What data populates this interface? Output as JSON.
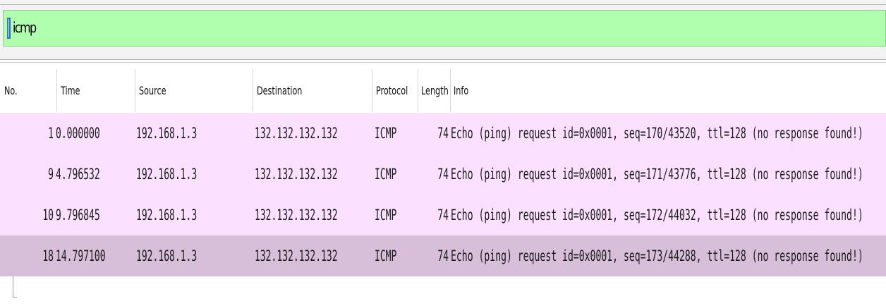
{
  "filter": {
    "value": "icmp"
  },
  "columns": [
    {
      "key": "no",
      "label": "No."
    },
    {
      "key": "time",
      "label": "Time"
    },
    {
      "key": "source",
      "label": "Source"
    },
    {
      "key": "destination",
      "label": "Destination"
    },
    {
      "key": "protocol",
      "label": "Protocol"
    },
    {
      "key": "length",
      "label": "Length"
    },
    {
      "key": "info",
      "label": "Info"
    }
  ],
  "packets": [
    {
      "no": "1",
      "time": "0.000000",
      "source": "192.168.1.3",
      "destination": "132.132.132.132",
      "protocol": "ICMP",
      "length": "74",
      "info": "Echo (ping) request  id=0x0001, seq=170/43520, ttl=128 (no response found!)",
      "selected": false
    },
    {
      "no": "9",
      "time": "4.796532",
      "source": "192.168.1.3",
      "destination": "132.132.132.132",
      "protocol": "ICMP",
      "length": "74",
      "info": "Echo (ping) request  id=0x0001, seq=171/43776, ttl=128 (no response found!)",
      "selected": false
    },
    {
      "no": "10",
      "time": "9.796845",
      "source": "192.168.1.3",
      "destination": "132.132.132.132",
      "protocol": "ICMP",
      "length": "74",
      "info": "Echo (ping) request  id=0x0001, seq=172/44032, ttl=128 (no response found!)",
      "selected": false
    },
    {
      "no": "18",
      "time": "14.797100",
      "source": "192.168.1.3",
      "destination": "132.132.132.132",
      "protocol": "ICMP",
      "length": "74",
      "info": "Echo (ping) request  id=0x0001, seq=173/44288, ttl=128 (no response found!)",
      "selected": true
    }
  ],
  "colors": {
    "filter_valid_bg": "#afffaf",
    "icmp_row_bg": "#fce0ff",
    "selected_row_bg": "#d7bfda"
  }
}
